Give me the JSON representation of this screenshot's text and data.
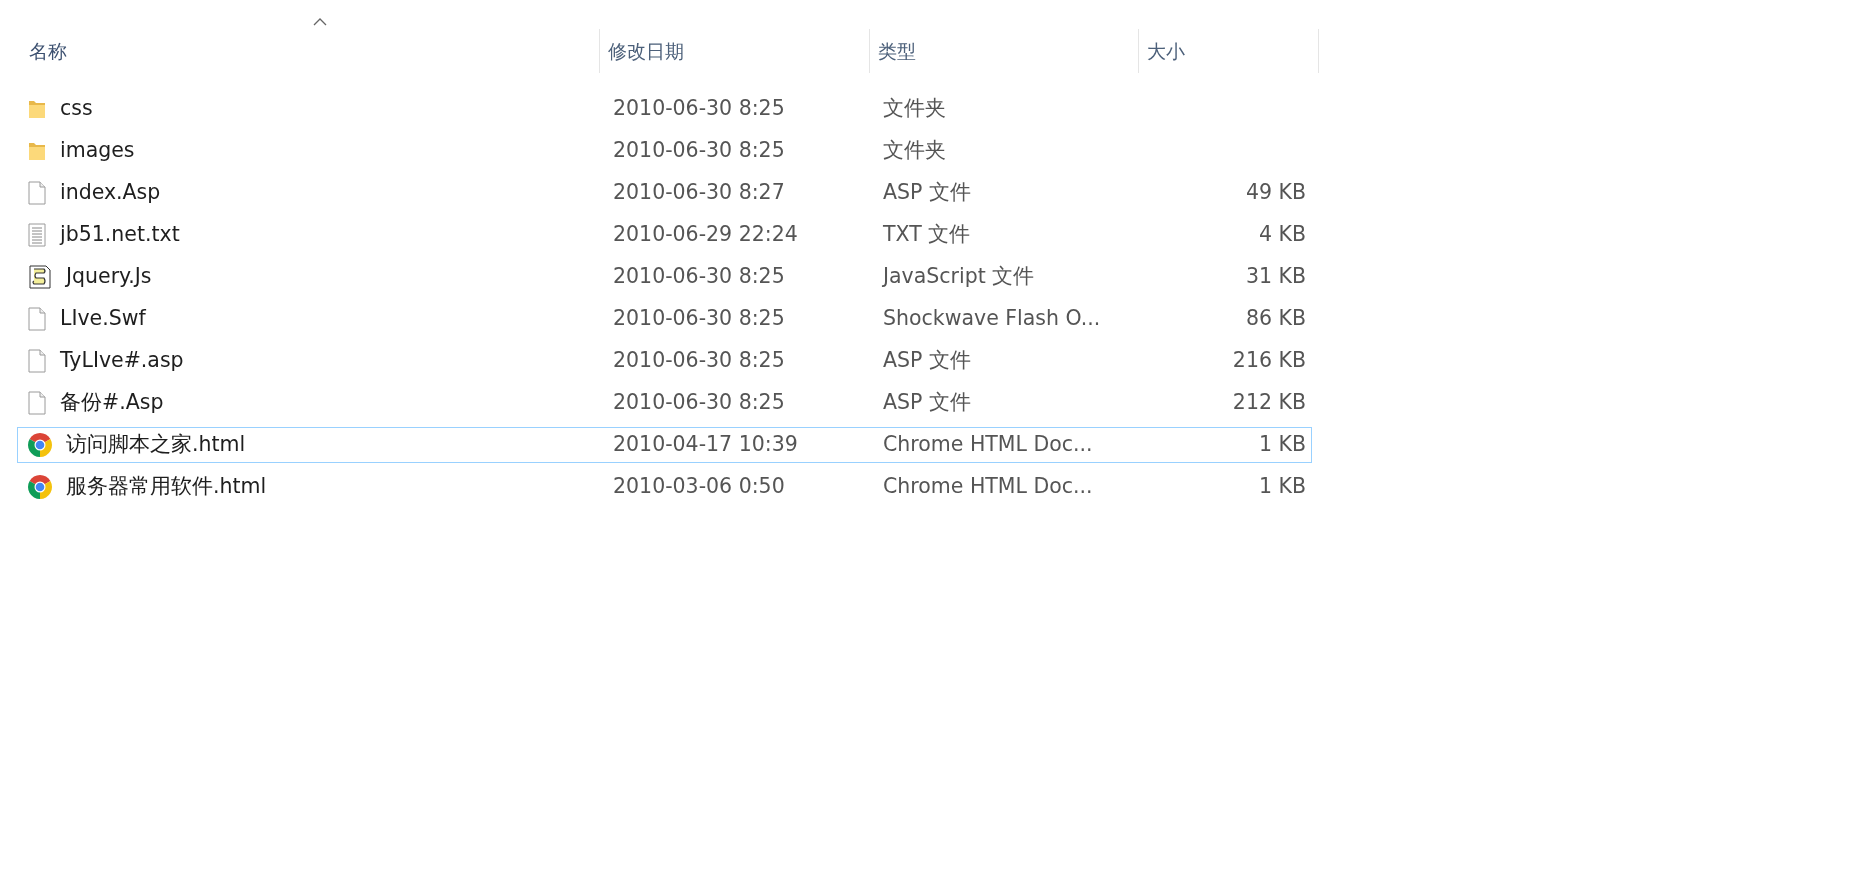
{
  "columns": [
    {
      "label": "名称",
      "sorted": true
    },
    {
      "label": "修改日期",
      "sorted": false
    },
    {
      "label": "类型",
      "sorted": false
    },
    {
      "label": "大小",
      "sorted": false
    }
  ],
  "files": [
    {
      "kind": "folder",
      "name": "css",
      "date": "2010-06-30 8:25",
      "type": "文件夹",
      "focused": false
    },
    {
      "kind": "folder",
      "name": "images",
      "date": "2010-06-30 8:25",
      "type": "文件夹",
      "focused": false
    },
    {
      "kind": "file",
      "name": "index.Asp",
      "date": "2010-06-30 8:27",
      "type": "ASP 文件",
      "size": "49 KB",
      "focused": false
    },
    {
      "kind": "text",
      "name": "jb51.net.txt",
      "date": "2010-06-29 22:24",
      "type": "TXT 文件",
      "size": "4 KB",
      "focused": false
    },
    {
      "kind": "script",
      "name": "Jquery.Js",
      "date": "2010-06-30 8:25",
      "type": "JavaScript 文件",
      "size": "31 KB",
      "focused": false
    },
    {
      "kind": "file",
      "name": "LIve.Swf",
      "date": "2010-06-30 8:25",
      "type": "Shockwave Flash O...",
      "size": "86 KB",
      "focused": false
    },
    {
      "kind": "file",
      "name": "TyLIve#.asp",
      "date": "2010-06-30 8:25",
      "type": "ASP 文件",
      "size": "216 KB",
      "focused": false
    },
    {
      "kind": "file",
      "name": "备份#.Asp",
      "date": "2010-06-30 8:25",
      "type": "ASP 文件",
      "size": "212 KB",
      "focused": false
    },
    {
      "kind": "chrome",
      "name": "访问脚本之家.html",
      "date": "2010-04-17 10:39",
      "type": "Chrome HTML Doc...",
      "size": "1 KB",
      "focused": true
    },
    {
      "kind": "chrome",
      "name": "服务器常用软件.html",
      "date": "2010-03-06 0:50",
      "type": "Chrome HTML Doc...",
      "size": "1 KB",
      "focused": false
    }
  ]
}
